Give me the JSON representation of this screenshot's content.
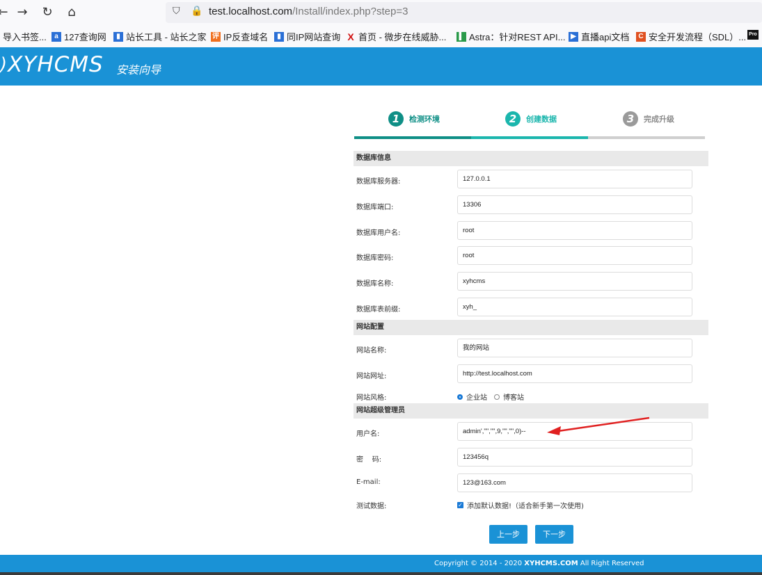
{
  "browser": {
    "url_host": "test.localhost.com",
    "url_path": "/Install/index.php?step=3",
    "bookmarks": [
      {
        "label": "导入书签...",
        "icon": "folder-icon"
      },
      {
        "label": "127查询网",
        "icon": "a-icon"
      },
      {
        "label": "站长工具 - 站长之家",
        "icon": "chart-icon"
      },
      {
        "label": "IP反查域名",
        "icon": "ip-icon"
      },
      {
        "label": "同IP网站查询",
        "icon": "chart-icon"
      },
      {
        "label": "首页 - 微步在线威胁...",
        "icon": "x-icon"
      },
      {
        "label": "Astra：针对REST API...",
        "icon": "astra-icon"
      },
      {
        "label": "直播api文档",
        "icon": "play-icon"
      },
      {
        "label": "安全开发流程（SDL）...",
        "icon": "c-icon"
      },
      {
        "label": "Pro",
        "icon": "pro-icon"
      }
    ]
  },
  "header": {
    "logo": "XYHCMS",
    "subtitle": "安装向导"
  },
  "steps": [
    {
      "num": "1",
      "label": "检测环境",
      "color": "#0f8f86"
    },
    {
      "num": "2",
      "label": "创建数据",
      "color": "#1bb6ad"
    },
    {
      "num": "3",
      "label": "完成升级",
      "color": "#9a9a9a"
    }
  ],
  "sections": {
    "db": "数据库信息",
    "site": "网站配置",
    "admin": "网站超级管理员"
  },
  "fields": {
    "db_host": {
      "label": "数据库服务器:",
      "value": "127.0.0.1"
    },
    "db_port": {
      "label": "数据库端口:",
      "value": "13306"
    },
    "db_user": {
      "label": "数据库用户名:",
      "value": "root"
    },
    "db_pass": {
      "label": "数据库密码:",
      "value": "root"
    },
    "db_name": {
      "label": "数据库名称:",
      "value": "xyhcms"
    },
    "db_prefix": {
      "label": "数据库表前缀:",
      "value": "xyh_"
    },
    "site_name": {
      "label": "网站名称:",
      "value": "我的网站"
    },
    "site_url": {
      "label": "网站网址:",
      "value": "http://test.localhost.com"
    },
    "site_style": {
      "label": "网站风格:",
      "opt1": "企业站",
      "opt2": "博客站"
    },
    "username": {
      "label": "用户名:",
      "value": "admin',\"\",\"\",9,\"\",\"\",0)--"
    },
    "password": {
      "label": "密    码:",
      "value": "123456q"
    },
    "email": {
      "label": "E-mail:",
      "value": "123@163.com"
    },
    "test_data": {
      "label": "测试数据:",
      "checkbox_label": "添加默认数据!（适合新手第一次使用)"
    }
  },
  "buttons": {
    "prev": "上一步",
    "next": "下一步"
  },
  "footer": {
    "prefix": "Copyright © 2014 - 2020 ",
    "brand": "XYHCMS.COM",
    "suffix": " All Right Reserved"
  },
  "colors": {
    "accent": "#1a92d6",
    "annotation_arrow": "#e02020"
  }
}
